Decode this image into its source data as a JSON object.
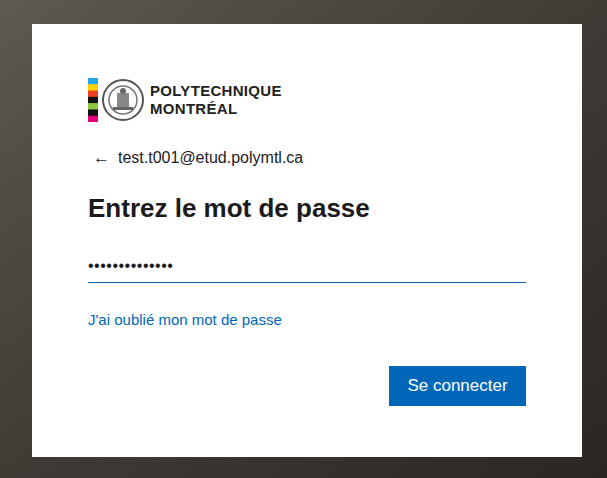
{
  "logo": {
    "lines": [
      "POLYTECHNIQUE",
      "MONTRÉAL"
    ]
  },
  "account": {
    "back_icon": "←",
    "email": "test.t001@etud.polymtl.ca"
  },
  "heading": "Entrez le mot de passe",
  "password_field": {
    "value": "••••••••••••••",
    "focused": true
  },
  "links": [
    "J'ai oublié mon mot de passe"
  ],
  "buttons": [
    "Se connecter"
  ]
}
